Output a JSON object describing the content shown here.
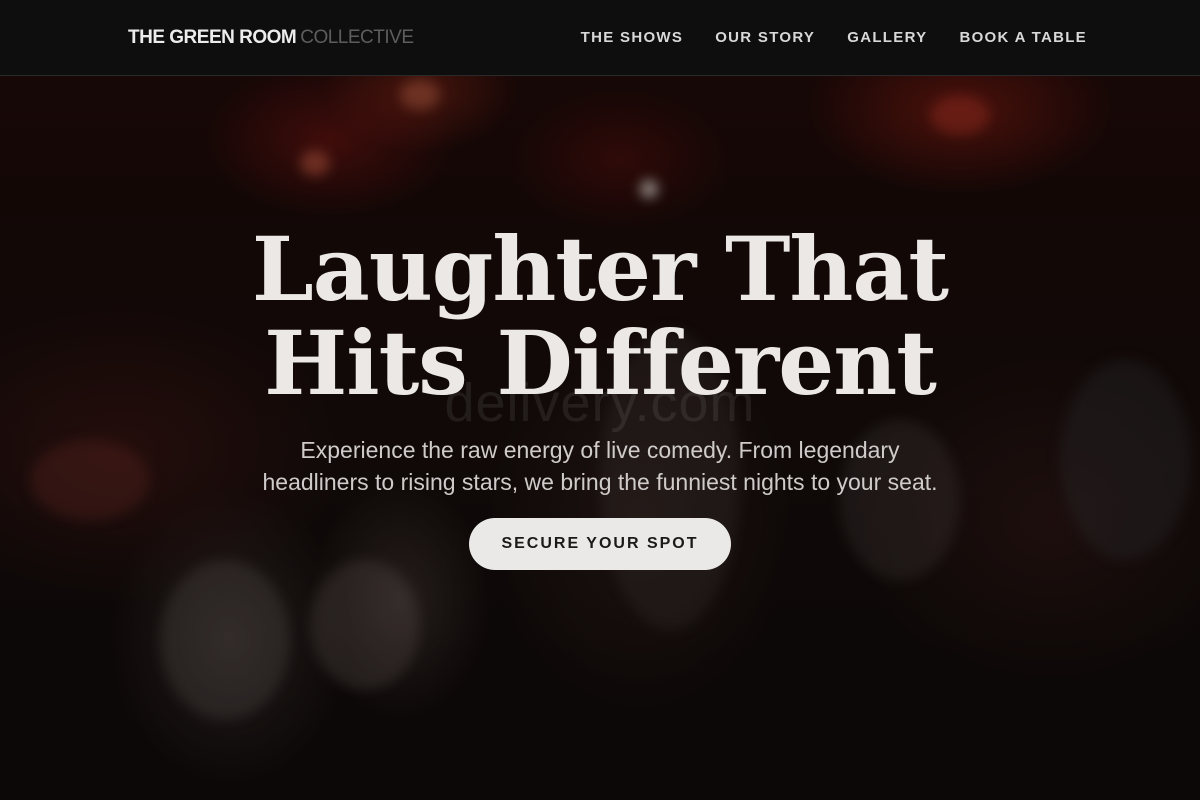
{
  "header": {
    "logo_main": "THE GREEN ROOM",
    "logo_sub": "COLLECTIVE",
    "nav": [
      {
        "label": "THE SHOWS"
      },
      {
        "label": "OUR STORY"
      },
      {
        "label": "GALLERY"
      },
      {
        "label": "BOOK A TABLE"
      }
    ]
  },
  "hero": {
    "title": "Laughter That Hits Different",
    "subtitle": "Experience the raw energy of live comedy. From legendary headliners to rising stars, we bring the funniest nights to your seat.",
    "cta_label": "SECURE YOUR SPOT",
    "watermark": "delivery.com"
  },
  "colors": {
    "header_bg": "#0e0e0e",
    "nav_text": "#d8d8d8",
    "title_text": "#ebe8e6",
    "cta_bg": "#ebe9e8",
    "cta_text": "#1a1a1a"
  }
}
